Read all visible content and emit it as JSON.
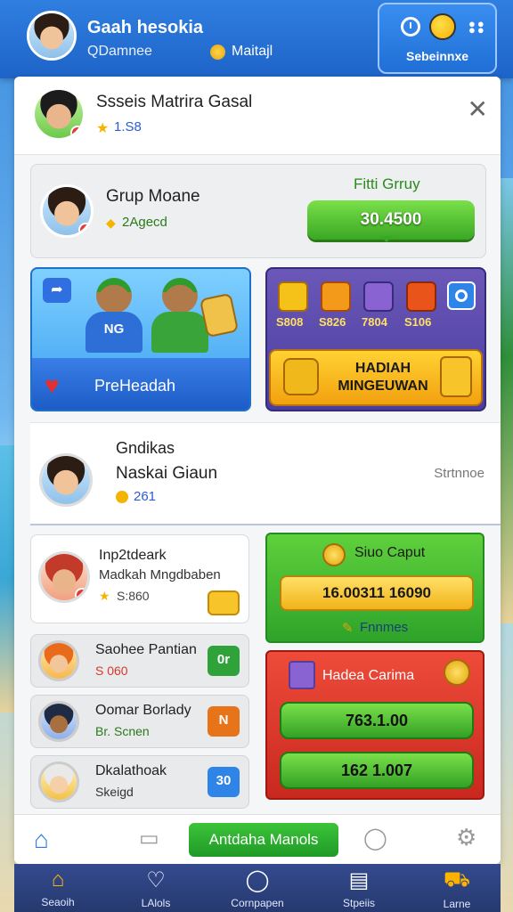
{
  "topbar": {
    "user_name": "Gaah hesokia",
    "subtitle": "QDamnee",
    "coin_label": "Maitajl",
    "panel_label": "Sebeinnxe"
  },
  "header": {
    "title": "Ssseis Matrira Gasal",
    "rating": "1.S8"
  },
  "group": {
    "name": "Grup Moane",
    "sub": "2Agecd",
    "label": "Fitti Grruy",
    "button_value": "30.4500"
  },
  "promo": {
    "label": "PreHeadah",
    "shirt_text": "NG"
  },
  "rewards": {
    "values": [
      "S808",
      "S826",
      "7804",
      "S106"
    ],
    "button_label": "HADIAH MINGEUWAN"
  },
  "contact": {
    "line1": "Gndikas",
    "line2": "Naskai Giaun",
    "count": "261",
    "right_label": "Strtnnoe"
  },
  "friend": {
    "name": "Inp2tdeark",
    "sub": "Madkah Mngdbaben",
    "score": "S:860"
  },
  "small_rows": [
    {
      "name": "Saohee Pantian",
      "sub": "S 060",
      "btn": "0r",
      "btn_color": "#2fa33a",
      "sub_color": "#d43a2a"
    },
    {
      "name": "Oomar Borlady",
      "sub": "Br. Scnen",
      "btn": "N",
      "btn_color": "#e8741a",
      "sub_color": "#2a7a1a"
    },
    {
      "name": "Dkalathoak",
      "sub": "Skeigd",
      "btn": "30",
      "btn_color": "#2f84e8",
      "sub_color": "#333333"
    }
  ],
  "group_card": {
    "title": "Siuo Caput",
    "value": "16.00311 16090",
    "footer": "Fnnmes"
  },
  "hadea_card": {
    "title": "Hadea Carima",
    "value1": "763.1.00",
    "value2": "162 1.007"
  },
  "action_bar": {
    "button_label": "Antdaha Manols"
  },
  "bottom_nav": [
    {
      "label": "Seaoih",
      "icon": "home-icon"
    },
    {
      "label": "LAlols",
      "icon": "heart-icon"
    },
    {
      "label": "Cornpapen",
      "icon": "info-icon"
    },
    {
      "label": "Stpeiis",
      "icon": "notes-icon"
    },
    {
      "label": "Larne",
      "icon": "cart-icon"
    }
  ]
}
